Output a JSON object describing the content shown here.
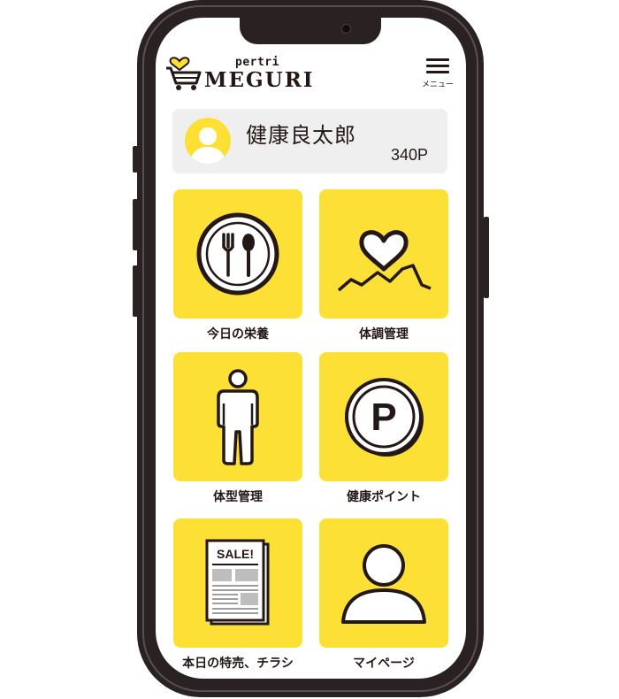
{
  "app": {
    "logo_small_text": "pertri",
    "logo_main_text": "MEGURI",
    "menu_label": "メニュー"
  },
  "profile": {
    "name": "健康良太郎",
    "points": "340P"
  },
  "tiles": [
    {
      "label": "今日の栄養",
      "icon": "plate-fork-spoon-icon"
    },
    {
      "label": "体調管理",
      "icon": "heart-chart-icon"
    },
    {
      "label": "体型管理",
      "icon": "person-body-icon"
    },
    {
      "label": "健康ポイント",
      "icon": "point-coin-icon"
    },
    {
      "label": "本日の特売、チラシ",
      "icon": "sale-flyer-icon",
      "icon_text": "SALE!"
    },
    {
      "label": "マイページ",
      "icon": "user-profile-icon"
    }
  ],
  "colors": {
    "accent": "#fde036",
    "text": "#231815",
    "card": "#efefef",
    "frame": "#2a2222"
  }
}
